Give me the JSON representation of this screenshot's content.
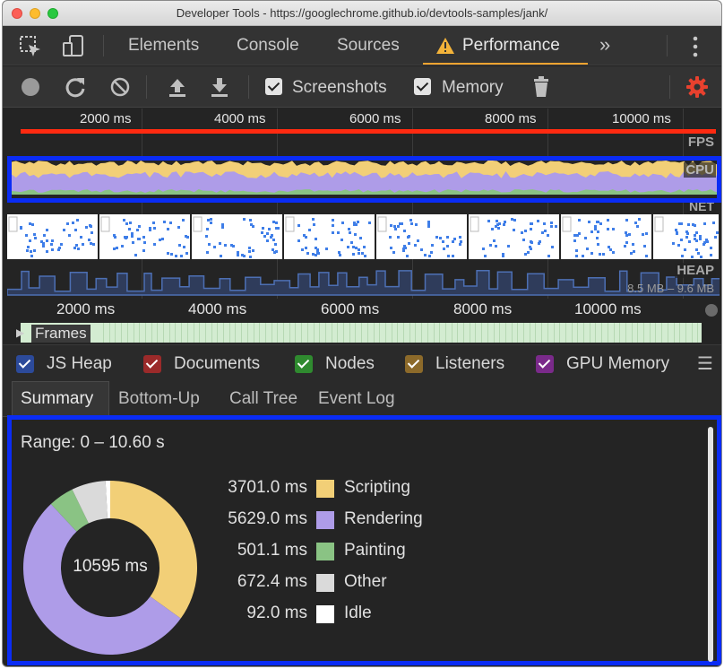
{
  "window": {
    "title": "Developer Tools - https://googlechrome.github.io/devtools-samples/jank/"
  },
  "tabs": [
    "Elements",
    "Console",
    "Sources",
    "Performance"
  ],
  "active_tab": "Performance",
  "toolbar": {
    "screenshots_label": "Screenshots",
    "memory_label": "Memory",
    "screenshots_checked": true,
    "memory_checked": true
  },
  "overview": {
    "ruler_labels": [
      "2000 ms",
      "4000 ms",
      "6000 ms",
      "8000 ms",
      "10000 ms"
    ],
    "tracks": {
      "fps": "FPS",
      "cpu": "CPU",
      "net": "NET",
      "heap": "HEAP"
    },
    "heap_range": "8.5 MB – 9.6 MB"
  },
  "frames": {
    "ruler_labels": [
      "2000 ms",
      "4000 ms",
      "6000 ms",
      "8000 ms",
      "10000 ms"
    ],
    "label": "Frames"
  },
  "memory_legend": [
    {
      "label": "JS Heap",
      "color": "#2c4a9a",
      "checked": true
    },
    {
      "label": "Documents",
      "color": "#9b2a2a",
      "checked": true
    },
    {
      "label": "Nodes",
      "color": "#2f8a2f",
      "checked": true
    },
    {
      "label": "Listeners",
      "color": "#8c6a2a",
      "checked": true
    },
    {
      "label": "GPU Memory",
      "color": "#7a2a8a",
      "checked": true
    }
  ],
  "subtabs": [
    "Summary",
    "Bottom-Up",
    "Call Tree",
    "Event Log"
  ],
  "active_subtab": "Summary",
  "summary": {
    "range": "Range: 0 – 10.60 s",
    "total": "10595 ms",
    "items": [
      {
        "value": "3701.0 ms",
        "name": "Scripting",
        "color": "#f2cf77",
        "ms": 3701.0
      },
      {
        "value": "5629.0 ms",
        "name": "Rendering",
        "color": "#ae9ce8",
        "ms": 5629.0
      },
      {
        "value": "501.1 ms",
        "name": "Painting",
        "color": "#8ac384",
        "ms": 501.1
      },
      {
        "value": "672.4 ms",
        "name": "Other",
        "color": "#dadada",
        "ms": 672.4
      },
      {
        "value": "92.0 ms",
        "name": "Idle",
        "color": "#ffffff",
        "ms": 92.0
      }
    ]
  },
  "colors": {
    "accent": "#f0a330",
    "highlight": "#0a2cf5",
    "settings": "#e8412e",
    "fps_bar": "#ff2a10",
    "net_heap": "#4d6fb3"
  }
}
